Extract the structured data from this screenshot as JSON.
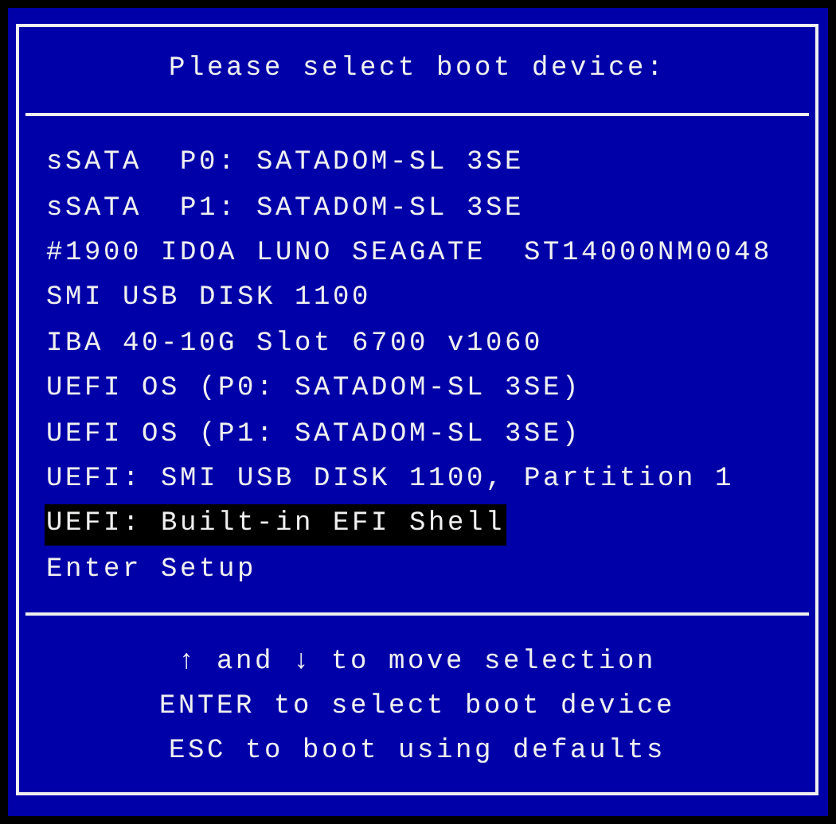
{
  "title": "Please select boot device:",
  "items": [
    {
      "label": "sSATA  P0: SATADOM-SL 3SE",
      "selected": false
    },
    {
      "label": "sSATA  P1: SATADOM-SL 3SE",
      "selected": false
    },
    {
      "label": "#1900 IDOA LUNO SEAGATE  ST14000NM0048",
      "selected": false
    },
    {
      "label": "SMI USB DISK 1100",
      "selected": false
    },
    {
      "label": "IBA 40-10G Slot 6700 v1060",
      "selected": false
    },
    {
      "label": "UEFI OS (P0: SATADOM-SL 3SE)",
      "selected": false
    },
    {
      "label": "UEFI OS (P1: SATADOM-SL 3SE)",
      "selected": false
    },
    {
      "label": "UEFI: SMI USB DISK 1100, Partition 1",
      "selected": false
    },
    {
      "label": "UEFI: Built-in EFI Shell",
      "selected": true
    },
    {
      "label": "Enter Setup",
      "selected": false
    }
  ],
  "help": [
    "↑ and ↓ to move selection",
    "ENTER to select boot device",
    "ESC to boot using defaults"
  ]
}
